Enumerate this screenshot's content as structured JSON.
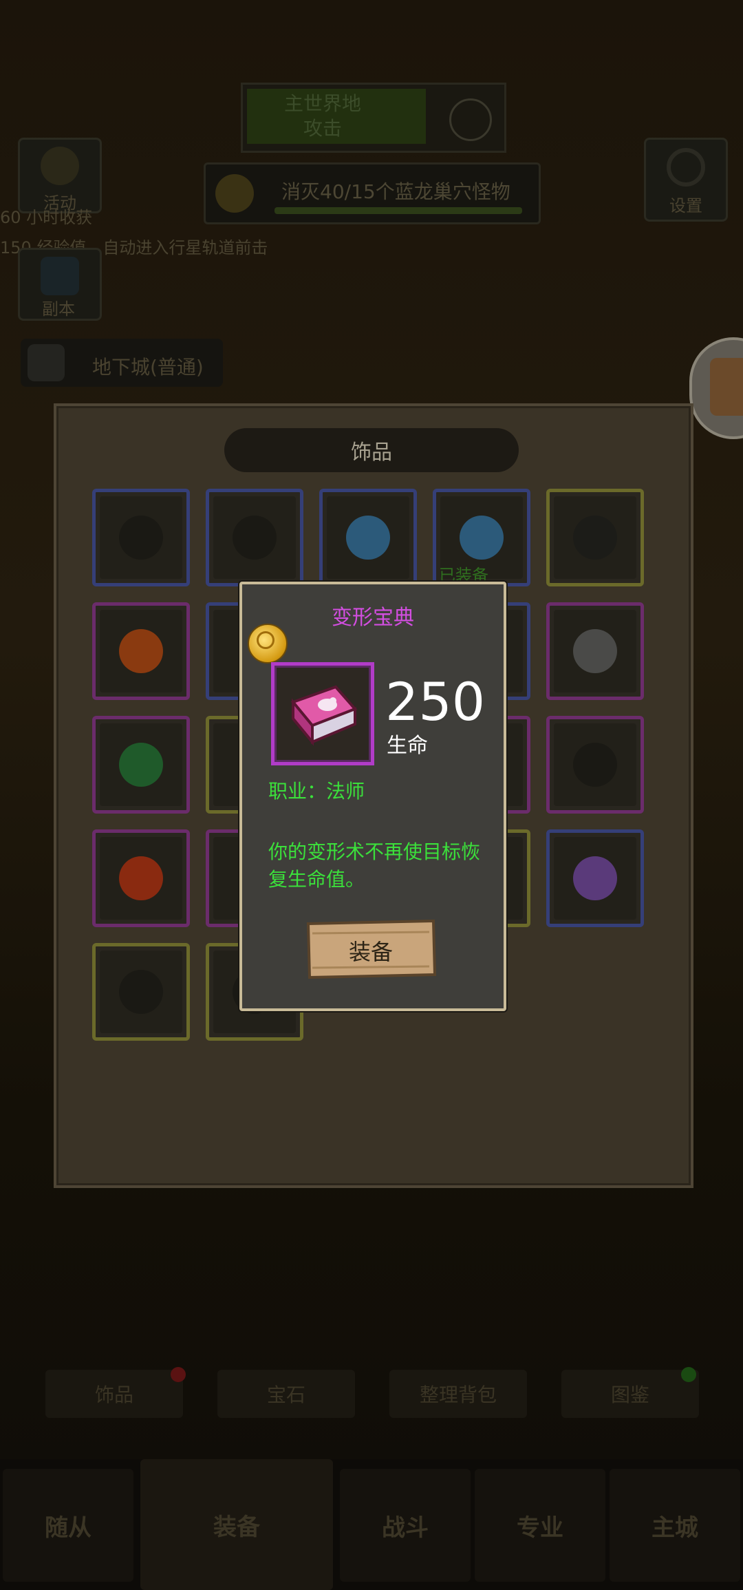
{
  "background": {
    "hunt_panel": {
      "line1": "主世界地",
      "line2": "攻击"
    },
    "top_left_button": "活动",
    "top_left_info1": "60 小时收获",
    "top_left_info2": "150 经验值，自动进入行星轨道前击",
    "dungeon_button": "副本",
    "dungeon_label": "地下城(普通)",
    "settings_label": "设置",
    "quest_text": "消灭40/15个蓝龙巢穴怪物",
    "sub_tabs": [
      "饰品",
      "宝石",
      "整理背包",
      "图鉴"
    ],
    "bottom_tabs": [
      "随从",
      "装备",
      "战斗",
      "专业",
      "主城"
    ]
  },
  "panel": {
    "title": "饰品",
    "equipped_tag": "已装备",
    "slots": [
      {
        "border": "blue",
        "icon": "locked-icon"
      },
      {
        "border": "blue",
        "icon": "locked-icon"
      },
      {
        "border": "blue",
        "icon": "water-drop-icon"
      },
      {
        "border": "blue",
        "icon": "snowflake-icon"
      },
      {
        "border": "yellow",
        "icon": "garlic-icon"
      },
      {
        "border": "purple",
        "icon": "fire-icon"
      },
      {
        "border": "blue",
        "icon": "hidden"
      },
      {
        "border": "blue",
        "icon": "hidden"
      },
      {
        "border": "blue",
        "icon": "blue-hat-icon"
      },
      {
        "border": "purple",
        "icon": "c-ring-icon"
      },
      {
        "border": "purple",
        "icon": "green-shield-icon"
      },
      {
        "border": "yellow",
        "icon": "hidden"
      },
      {
        "border": "purple",
        "icon": "hidden"
      },
      {
        "border": "purple",
        "icon": "hidden"
      },
      {
        "border": "purple",
        "icon": "locked-icon"
      },
      {
        "border": "purple",
        "icon": "flame-icon"
      },
      {
        "border": "purple",
        "icon": "hidden"
      },
      {
        "border": "yellow",
        "icon": "hidden"
      },
      {
        "border": "yellow",
        "icon": "hidden"
      },
      {
        "border": "blue",
        "icon": "purple-egg-icon"
      },
      {
        "border": "yellow",
        "icon": "locked-icon"
      },
      {
        "border": "yellow",
        "icon": "locked-icon"
      }
    ]
  },
  "popup": {
    "item_name": "变形宝典",
    "stat_value": "250",
    "stat_label": "生命",
    "class_requirement": "职业：法师",
    "description": "你的变形术不再使目标恢复生命值。",
    "equip_button": "装备",
    "colors": {
      "name": "#d24ee0",
      "effect_text": "#3be03b",
      "frame": "#b13cc8",
      "popup_border": "#c9bb98"
    }
  }
}
